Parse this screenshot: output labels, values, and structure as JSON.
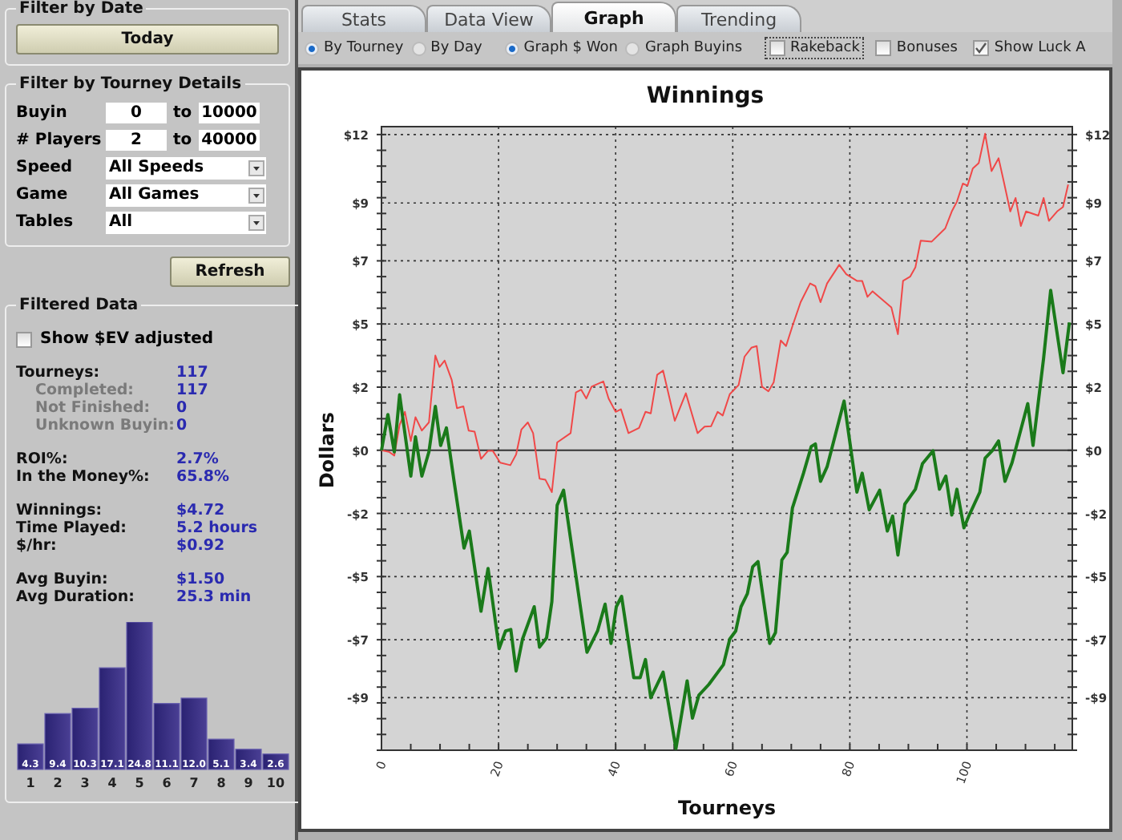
{
  "filter_by_date": {
    "title": "Filter by Date",
    "button": "Today"
  },
  "tourney_filter": {
    "title": "Filter by Tourney Details",
    "rows": [
      {
        "kind": "range",
        "label": "Buyin",
        "from": "0",
        "to_label": "to",
        "to": "10000"
      },
      {
        "kind": "range",
        "label": "# Players",
        "from": "2",
        "to_label": "to",
        "to": "40000"
      },
      {
        "kind": "select",
        "label": "Speed",
        "value": "All Speeds"
      },
      {
        "kind": "select",
        "label": "Game",
        "value": "All Games"
      },
      {
        "kind": "select",
        "label": "Tables",
        "value": "All"
      }
    ],
    "button": "Refresh"
  },
  "filtered_data": {
    "title": "Filtered Data",
    "checkbox": {
      "label": "Show $EV adjusted",
      "checked": false
    },
    "stat_groups": [
      [
        {
          "kind": "main",
          "label": "Tourneys:",
          "value": "117"
        },
        {
          "kind": "sub",
          "label": "Completed:",
          "value": "117"
        },
        {
          "kind": "sub",
          "label": "Not Finished:",
          "value": "0"
        },
        {
          "kind": "sub",
          "label": "Unknown Buyin:",
          "value": "0"
        }
      ],
      [
        {
          "kind": "main",
          "label": "ROI%:",
          "value": "2.7%"
        },
        {
          "kind": "main",
          "label": "In the Money%:",
          "value": "65.8%"
        }
      ],
      [
        {
          "kind": "main",
          "label": "Winnings:",
          "value": "$4.72"
        },
        {
          "kind": "main",
          "label": "Time Played:",
          "value": "5.2 hours"
        },
        {
          "kind": "main",
          "label": "$/hr:",
          "value": "$0.92"
        }
      ],
      [
        {
          "kind": "main",
          "label": "Avg Buyin:",
          "value": "$1.50"
        },
        {
          "kind": "main",
          "label": "Avg Duration:",
          "value": "25.3 min"
        }
      ]
    ],
    "chart_data": {
      "type": "bar",
      "categories": [
        "1",
        "2",
        "3",
        "4",
        "5",
        "6",
        "7",
        "8",
        "9",
        "10"
      ],
      "values": [
        4.3,
        9.4,
        10.3,
        17.1,
        24.8,
        11.1,
        12.0,
        5.1,
        3.4,
        2.6
      ],
      "value_labels": [
        "4.3",
        "9.4",
        "10.3",
        "17.1",
        "24.8",
        "11.1",
        "12.0",
        "5.1",
        "3.4",
        "2.6"
      ],
      "data_labels": true
    }
  },
  "tabs": [
    {
      "label": "Stats",
      "selected": false
    },
    {
      "label": "Data View",
      "selected": false
    },
    {
      "label": "Graph",
      "selected": true
    },
    {
      "label": "Trending",
      "selected": false
    }
  ],
  "options": {
    "radio_groups": [
      [
        {
          "label": "By Tourney",
          "selected": true
        },
        {
          "label": "By Day",
          "selected": false
        }
      ],
      [
        {
          "label": "Graph $ Won",
          "selected": true
        },
        {
          "label": "Graph Buyins",
          "selected": false
        }
      ]
    ],
    "checkboxes": [
      {
        "label": "Rakeback",
        "checked": false,
        "focused": true
      },
      {
        "label": "Bonuses",
        "checked": false,
        "focused": false
      },
      {
        "label": "Show Luck A",
        "checked": true,
        "focused": false
      }
    ]
  },
  "chart_data": {
    "type": "line",
    "title": "Winnings",
    "xlabel": "Tourneys",
    "ylabel": "Dollars",
    "xlim": [
      0,
      118
    ],
    "grid": true,
    "ylim": [
      -11.4,
      12.3
    ],
    "xticks": [
      0,
      20,
      40,
      60,
      80,
      100
    ],
    "yticks": [
      {
        "value": 12,
        "label": "$12"
      },
      {
        "value": 9.4,
        "label": "$9"
      },
      {
        "value": 7.2,
        "label": "$7"
      },
      {
        "value": 4.8,
        "label": "$5"
      },
      {
        "value": 2.4,
        "label": "$2"
      },
      {
        "value": 0,
        "label": "$0"
      },
      {
        "value": -2.4,
        "label": "-$2"
      },
      {
        "value": -4.8,
        "label": "-$5"
      },
      {
        "value": -7.2,
        "label": "-$7"
      },
      {
        "value": -9.4,
        "label": "-$9"
      }
    ],
    "series": [
      {
        "color": "#f04848",
        "x": [
          0,
          1.3,
          2.2,
          3.1,
          4,
          5,
          5.8,
          6.9,
          8.1,
          9.2,
          9.9,
          10.8,
          12,
          12.9,
          14,
          14.9,
          15.9,
          17,
          18.2,
          19,
          20.3,
          22,
          23,
          23.9,
          25,
          25.9,
          27,
          28,
          29.1,
          30,
          32.3,
          33.2,
          34.1,
          35,
          35.9,
          37.9,
          38.8,
          40,
          40.9,
          42.2,
          44,
          45.1,
          46,
          47.1,
          48.1,
          50.1,
          52,
          54,
          55.2,
          56.3,
          57.4,
          58.3,
          59.5,
          61,
          62,
          63.2,
          64.1,
          65,
          66.1,
          67,
          68.2,
          69.1,
          70.2,
          71.6,
          73.2,
          74.1,
          75,
          76.1,
          78.2,
          79.4,
          81.2,
          82.1,
          83,
          83.9,
          87.1,
          88.2,
          89.1,
          90.3,
          91.2,
          92.1,
          94,
          96.3,
          97.4,
          98.3,
          99.3,
          100.1,
          101,
          102,
          103.1,
          104.2,
          105.4,
          106.3,
          107.4,
          108.3,
          109.2,
          110.1,
          112.2,
          113.1,
          114,
          115.4,
          116.4,
          117.3
        ],
        "values": [
          0,
          -0.06,
          -0.2,
          0.96,
          1.46,
          0.35,
          1.26,
          0.75,
          1.06,
          3.6,
          3.17,
          3.41,
          2.68,
          1.6,
          1.67,
          0.75,
          0.71,
          -0.33,
          -0.02,
          -0.02,
          -0.47,
          -0.57,
          -0.16,
          0.79,
          1.06,
          0.65,
          -1.08,
          -1.12,
          -1.59,
          0.3,
          0.65,
          2.2,
          2.3,
          1.97,
          2.42,
          2.62,
          1.97,
          1.46,
          1.56,
          0.65,
          0.85,
          1.46,
          1.4,
          2.87,
          3.03,
          1.12,
          2.17,
          0.65,
          0.9,
          0.91,
          1.46,
          1.32,
          2.13,
          2.48,
          3.56,
          3.9,
          3.96,
          2.42,
          2.24,
          2.58,
          4.17,
          3.96,
          4.72,
          5.63,
          6.34,
          6.24,
          5.63,
          6.34,
          7.05,
          6.69,
          6.44,
          6.44,
          5.83,
          6.04,
          5.43,
          4.41,
          6.44,
          6.6,
          6.95,
          7.97,
          7.93,
          8.43,
          9.08,
          9.45,
          10.14,
          10.06,
          10.71,
          10.91,
          12.03,
          10.61,
          11.1,
          10.2,
          9.08,
          9.59,
          8.52,
          9.08,
          8.92,
          9.59,
          8.72,
          9.08,
          9.25,
          10.1
        ]
      },
      {
        "color": "#1a7a1a",
        "x": [
          0,
          1.1,
          2.2,
          3.1,
          5,
          5.8,
          6.9,
          8.1,
          9.2,
          10.1,
          11.1,
          12.4,
          14.1,
          15,
          17,
          18.2,
          20.1,
          21.2,
          22.1,
          23,
          24.1,
          26.1,
          27,
          28.2,
          29.1,
          30,
          31.1,
          35.1,
          36.9,
          38.2,
          39.2,
          40.1,
          41,
          43.1,
          44.2,
          45.1,
          46,
          48.1,
          50.3,
          52.2,
          53.1,
          54.2,
          55.9,
          58.4,
          59.5,
          60.5,
          61.4,
          62.5,
          63.4,
          64.3,
          66.3,
          67.3,
          68.4,
          69.3,
          70.2,
          72.1,
          73.4,
          74.1,
          75,
          76.1,
          79,
          81.2,
          82.1,
          83.3,
          85.1,
          86.4,
          87.3,
          88.2,
          89.4,
          91.2,
          92.4,
          94.2,
          95.3,
          96.4,
          97.4,
          98.3,
          99.5,
          100.4,
          102.2,
          103.1,
          104.3,
          105.4,
          106.5,
          107.7,
          110.4,
          111.3,
          113.1,
          114.3,
          116.4,
          117.5
        ],
        "values": [
          0,
          1.36,
          -0.06,
          2.11,
          -0.98,
          0.51,
          -0.98,
          -0.06,
          1.67,
          0.18,
          0.85,
          -1.18,
          -3.72,
          -3.07,
          -6.12,
          -4.49,
          -7.54,
          -6.87,
          -6.81,
          -8.39,
          -7.17,
          -5.95,
          -7.48,
          -7.13,
          -5.75,
          -2.09,
          -1.52,
          -7.68,
          -6.87,
          -5.85,
          -7.34,
          -5.95,
          -5.55,
          -8.64,
          -8.64,
          -7.95,
          -9.41,
          -8.43,
          -11.34,
          -8.76,
          -10.18,
          -9.31,
          -8.9,
          -8.15,
          -7.17,
          -6.87,
          -5.95,
          -5.45,
          -4.43,
          -4.23,
          -7.34,
          -6.93,
          -4.17,
          -3.88,
          -2.19,
          -0.87,
          0.14,
          0.24,
          -1.18,
          -0.63,
          1.87,
          -1.59,
          -0.87,
          -2.26,
          -1.52,
          -3.07,
          -2.5,
          -3.98,
          -2.05,
          -1.48,
          -0.51,
          -0.02,
          -1.48,
          -0.98,
          -2.46,
          -1.48,
          -2.95,
          -2.46,
          -1.59,
          -0.3,
          -0.02,
          0.35,
          -1.18,
          -0.47,
          1.77,
          0.18,
          3.5,
          6.08,
          2.95,
          4.86
        ]
      }
    ]
  }
}
